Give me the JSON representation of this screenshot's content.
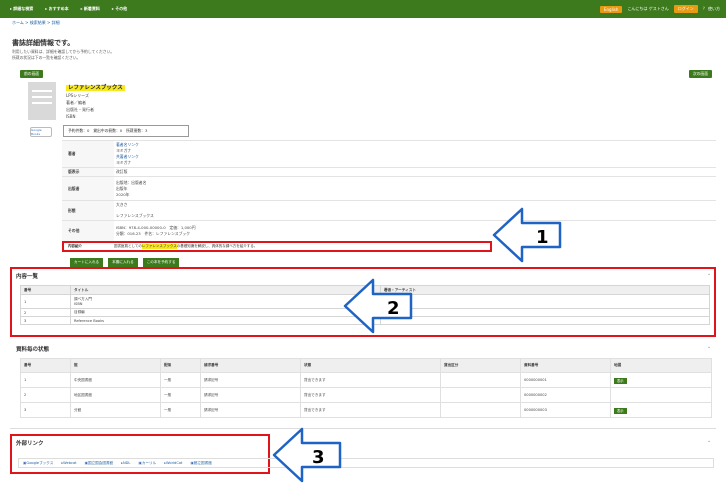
{
  "topbar": {
    "nav": [
      "詳細な検索",
      "おすすめ本",
      "新着資料",
      "その他"
    ],
    "nav_prefix": "▸",
    "lang": "English",
    "user": "こんにちは ゲストさん",
    "login": "ログイン",
    "help": "？ 使い方"
  },
  "breadcrumb": "ホーム > 検索結果 > 詳細",
  "page": {
    "title": "書誌詳細情報です。",
    "note1": "利用したい資料は、詳細を確認してから予約してください。",
    "note2": "所蔵の状況は下の一覧を確認ください。",
    "back_button": "前の画面",
    "next_button": "次の画面"
  },
  "book": {
    "title": "レファレンスブックス",
    "series": "LPSシリーズ",
    "author": "著者／編者",
    "publisher": "出版社・発行者",
    "isbn": "ISBN",
    "google_badge": "Google Books"
  },
  "availability": "予約件数：0　貸出中の冊数：0　所蔵冊数：3",
  "details": [
    {
      "key": "著者",
      "values": [
        "著者名リンク",
        "ヨミガナ",
        "共著者リンク",
        "ヨミガナ"
      ]
    },
    {
      "key": "版表示",
      "values": [
        "改訂版"
      ]
    },
    {
      "key": "出版者",
      "values": [
        "出版地：出版者名",
        "出版年",
        "2020年"
      ]
    },
    {
      "key": "形態",
      "values": [
        "大きさ",
        "レファレンスブックス"
      ]
    },
    {
      "key": "その他",
      "values": [
        "ISBN：978-4-000-00000-0　定価：1,000円",
        "分類：016.23　件名：レファレンスブック"
      ]
    }
  ],
  "annotation": {
    "key": "内容紹介",
    "text_before": "図書館員としての",
    "highlight": "レファレンスブックス",
    "text_after": "の基礎知識を解説し、具体的な調べ方を紹介する。"
  },
  "actions": [
    "カートに入れる",
    "本棚に入れる",
    "この本を予約する"
  ],
  "contents": {
    "heading": "内容一覧",
    "columns": [
      "番号",
      "タイトル",
      "著者・アーティスト"
    ],
    "rows": [
      {
        "no": "1",
        "title": "調べ方入門",
        "sub": "ISBN",
        "author": ""
      },
      {
        "no": "2",
        "title": "目録編",
        "sub": "",
        "author": ""
      },
      {
        "no": "3",
        "title": "Reference Books",
        "sub": "",
        "author": ""
      }
    ]
  },
  "holdings": {
    "heading": "資料毎の状態",
    "columns": [
      "番号",
      "館",
      "配架",
      "請求番号",
      "状態",
      "貸出区分",
      "資料番号",
      "地図"
    ],
    "rows": [
      {
        "no": "1",
        "lib": "中央図書館",
        "shelf": "一般",
        "call": "請求記号",
        "status": "貸出できます",
        "loan": "",
        "id": "0000000001",
        "map": "表示"
      },
      {
        "no": "2",
        "lib": "地区図書館",
        "shelf": "一般",
        "call": "請求記号",
        "status": "貸出できます",
        "loan": "",
        "id": "0000000002",
        "map": ""
      },
      {
        "no": "3",
        "lib": "分館",
        "shelf": "一般",
        "call": "請求記号",
        "status": "貸出できます",
        "loan": "",
        "id": "0000000003",
        "map": "表示"
      }
    ]
  },
  "external": {
    "heading": "外部リンク",
    "links": [
      "Googleブックス",
      "Webcat",
      "国立国会図書館",
      "NDL",
      "カーリル",
      "WorldCat",
      "都立図書館"
    ]
  },
  "callouts": [
    "1",
    "2",
    "3"
  ],
  "colors": {
    "nav_green": "#3d7a1e",
    "highlight": "#f6e91f",
    "annotation_red": "#e0141b",
    "login_orange": "#e89a12"
  }
}
